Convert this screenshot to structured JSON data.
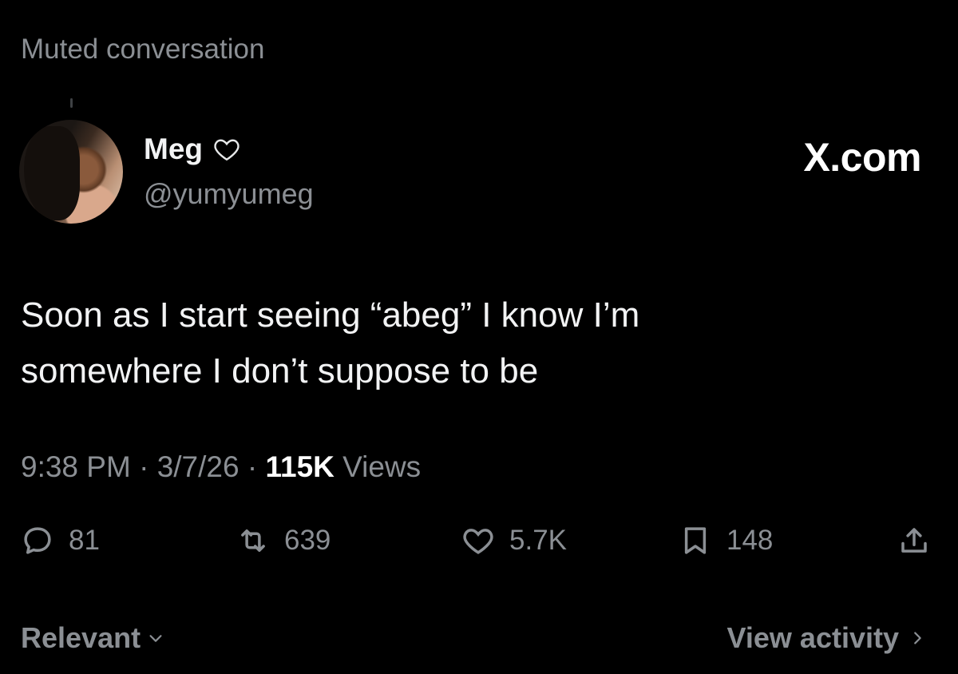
{
  "header": {
    "muted_label": "Muted conversation",
    "brand": "X.com"
  },
  "author": {
    "display_name": "Meg",
    "handle": "@yumyumeg",
    "name_icon": "heart-outline-icon"
  },
  "tweet": {
    "text_line1": "Soon as I start seeing “abeg” I know I’m",
    "text_line2": "somewhere I don’t suppose to be"
  },
  "meta": {
    "time": "9:38 PM",
    "date": "3/7/26",
    "views_count": "115K",
    "views_label": "Views",
    "separator": "·"
  },
  "actions": {
    "replies": "81",
    "reposts": "639",
    "likes": "5.7K",
    "bookmarks": "148"
  },
  "footer": {
    "sort_label": "Relevant",
    "activity_label": "View activity"
  },
  "colors": {
    "background": "#000000",
    "text": "#e7e9ea",
    "muted": "#8b8f94"
  }
}
